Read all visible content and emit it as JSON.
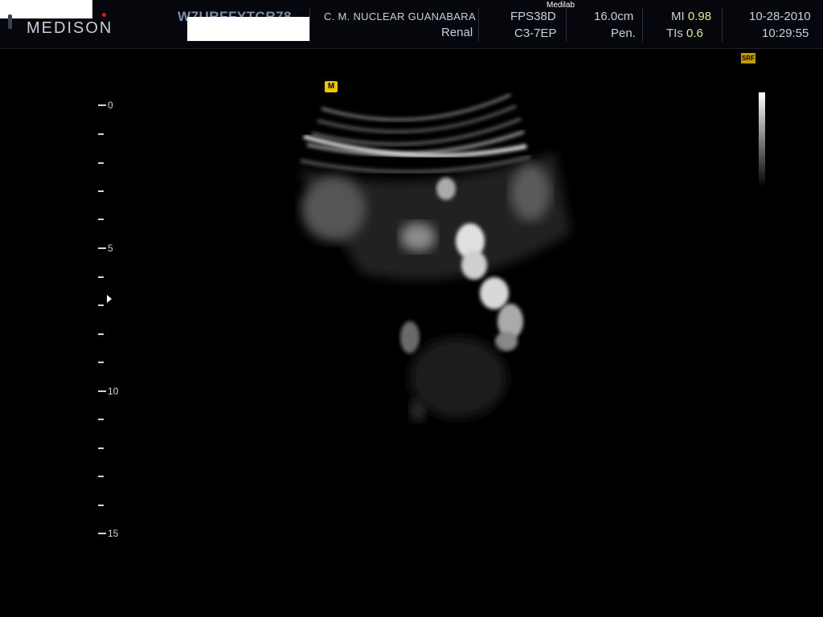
{
  "header": {
    "logo": "MEDISON",
    "patient_id": "W7URFFYTCR78",
    "institution": "C. M. NUCLEAR  GUANABARA",
    "exam": "Renal",
    "top_label": "Medilab",
    "fps_label": "FPS38D",
    "probe": "C3-7EP",
    "depth": "16.0cm",
    "preset": "Pen.",
    "mi_label": "MI",
    "mi_value": "0.98",
    "tis_label": "TIs",
    "tis_value": "0.6",
    "date": "10-28-2010",
    "time": "10:29:55"
  },
  "markers": {
    "probe_marker": "M",
    "sri_badge": "SRF"
  },
  "depth_scale": {
    "labels": [
      "0",
      "5",
      "10",
      "15"
    ]
  },
  "colors": {
    "background": "#000000",
    "value_highlight": "#d9ee9a",
    "marker_yellow": "#f2c500"
  }
}
